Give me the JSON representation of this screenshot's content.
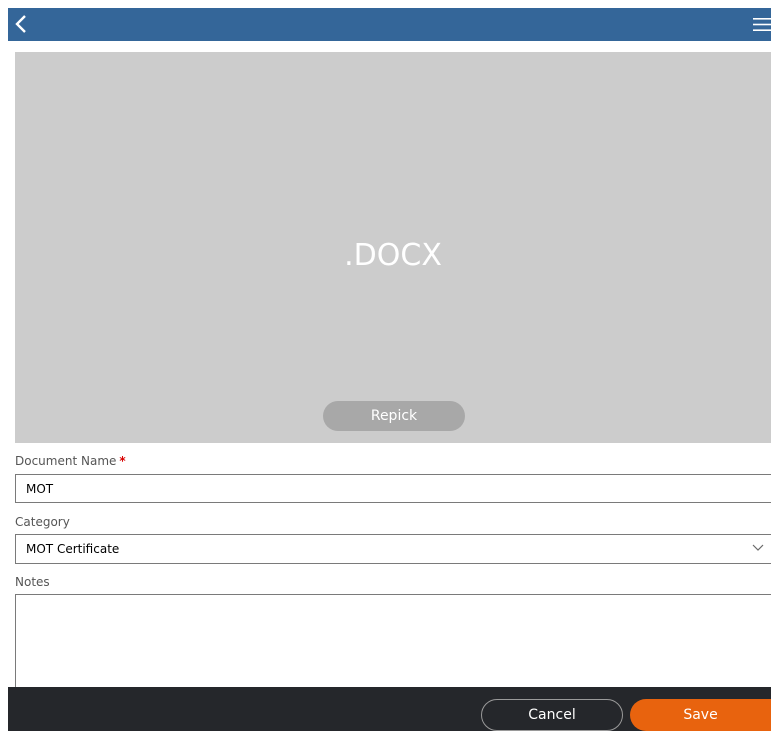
{
  "header": {
    "back_icon": "chevron-left-icon",
    "menu_icon": "hamburger-menu-icon",
    "background_color": "#346699"
  },
  "preview": {
    "file_extension": ".DOCX",
    "repick_label": "Repick"
  },
  "form": {
    "document_name": {
      "label": "Document Name",
      "required_mark": "*",
      "value": "MOT"
    },
    "category": {
      "label": "Category",
      "selected": "MOT Certificate"
    },
    "notes": {
      "label": "Notes",
      "value": ""
    }
  },
  "footer": {
    "cancel_label": "Cancel",
    "save_label": "Save",
    "save_color": "#e8630e"
  }
}
